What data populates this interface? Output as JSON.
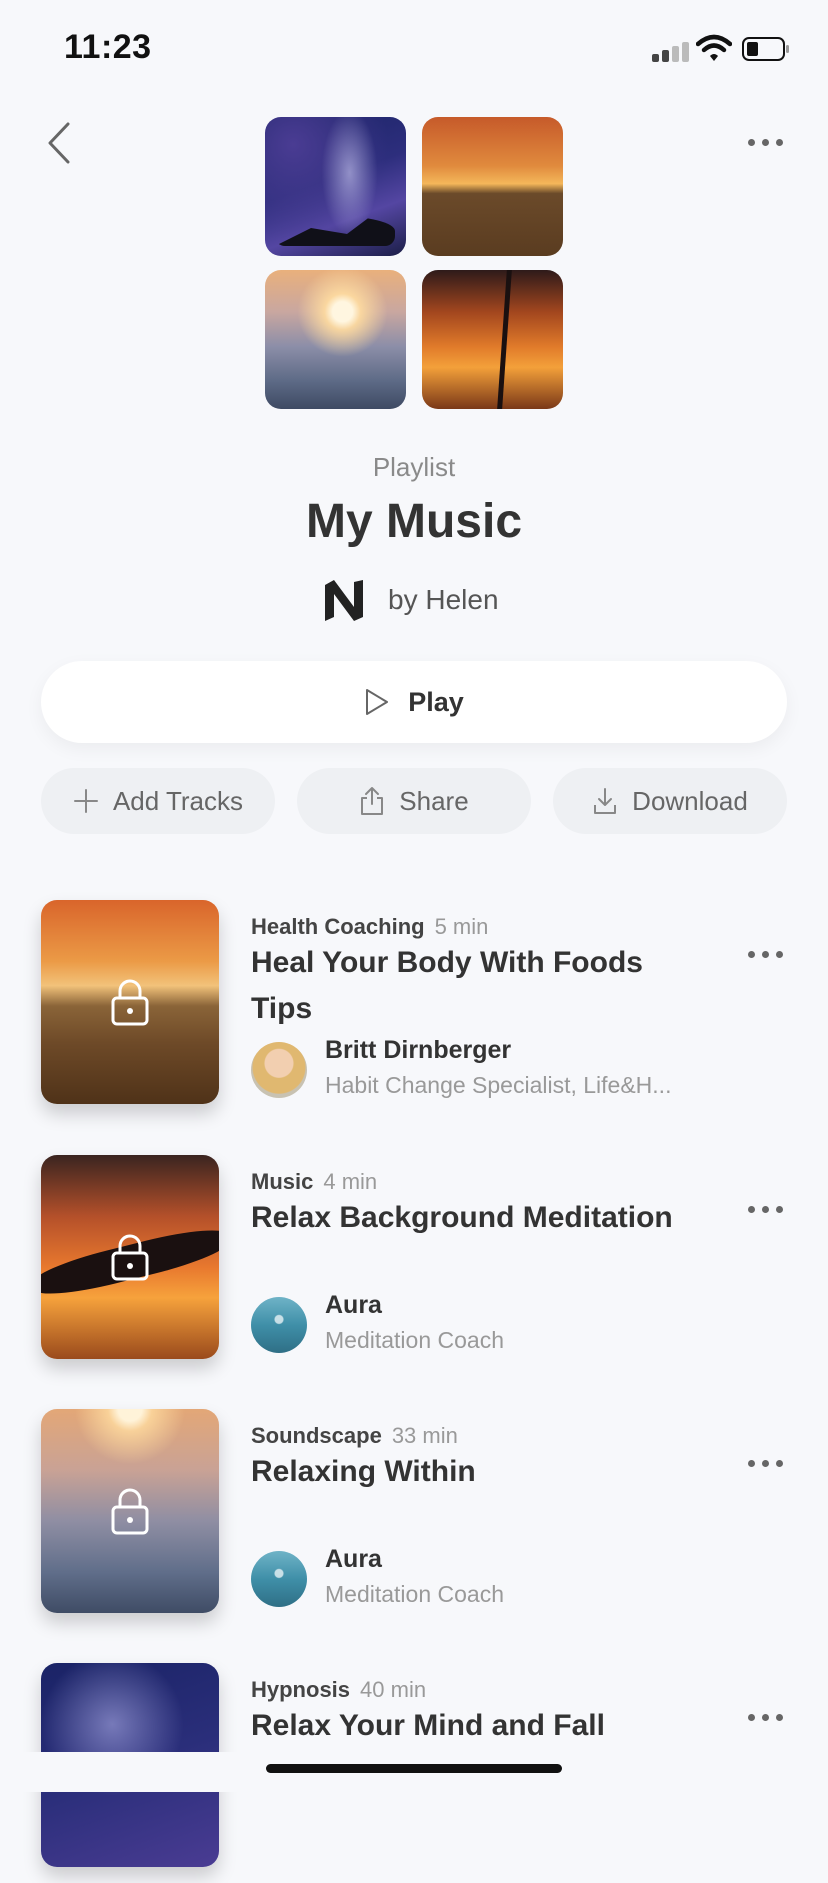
{
  "status_bar": {
    "time": "11:23"
  },
  "header": {
    "type_label": "Playlist",
    "title": "My Music",
    "author": "by Helen"
  },
  "actions": {
    "play_label": "Play",
    "add_tracks_label": "Add Tracks",
    "share_label": "Share",
    "download_label": "Download"
  },
  "tracks": [
    {
      "category": "Health Coaching",
      "duration": "5 min",
      "title": "Heal Your Body With Foods Tips",
      "coach_name": "Britt Dirnberger",
      "coach_role": "Habit Change Specialist, Life&H..."
    },
    {
      "category": "Music",
      "duration": "4 min",
      "title": "Relax Background Meditation",
      "coach_name": "Aura",
      "coach_role": "Meditation Coach"
    },
    {
      "category": "Soundscape",
      "duration": "33 min",
      "title": "Relaxing Within",
      "coach_name": "Aura",
      "coach_role": "Meditation Coach"
    },
    {
      "category": "Hypnosis",
      "duration": "40 min",
      "title": "Relax Your Mind and Fall"
    }
  ],
  "icons": {
    "back": "chevron-left-icon",
    "more": "more-horizontal-icon",
    "play": "play-icon",
    "add": "plus-icon",
    "share": "share-icon",
    "download": "download-icon",
    "lock": "lock-icon"
  }
}
